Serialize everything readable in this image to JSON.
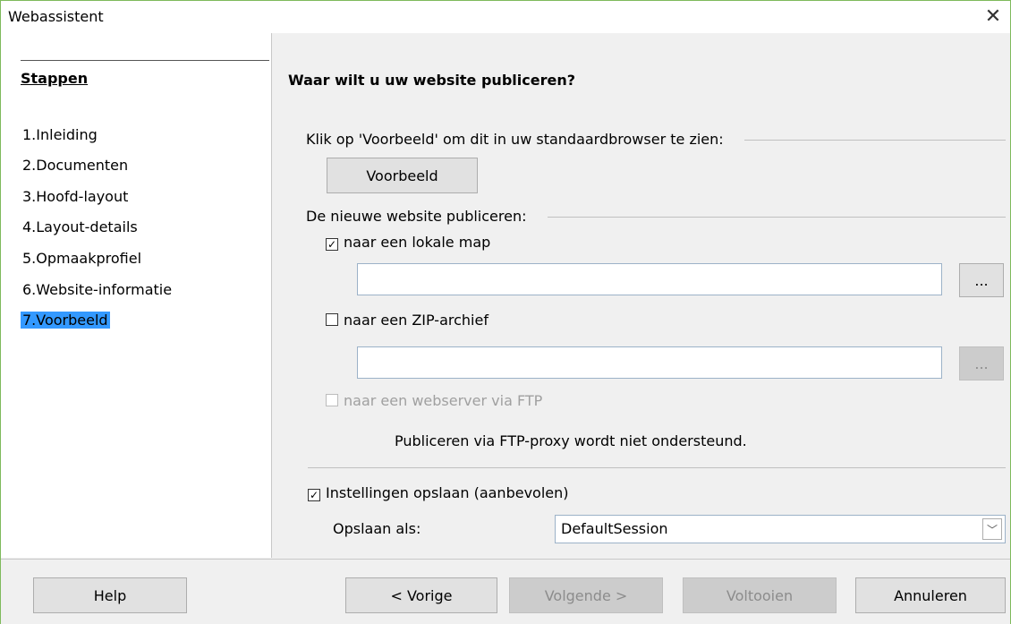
{
  "window": {
    "title": "Webassistent"
  },
  "sidebar": {
    "title": "Stappen",
    "steps": [
      "1.Inleiding",
      "2.Documenten",
      "3.Hoofd-layout",
      "4.Layout-details",
      "5.Opmaakprofiel",
      "6.Website-informatie",
      "7.Voorbeeld"
    ],
    "active_index": 6
  },
  "main": {
    "heading": "Waar wilt u uw website publiceren?",
    "preview_prompt": "Klik op 'Voorbeeld' om dit in uw standaardbrowser te zien:",
    "preview_button": "Voorbeeld",
    "publish_label": "De nieuwe website publiceren:",
    "local_folder": {
      "label": "naar een lokale map",
      "checked": true,
      "value": "",
      "browse": "..."
    },
    "zip_archive": {
      "label": "naar een ZIP-archief",
      "checked": false,
      "value": "",
      "browse": "..."
    },
    "ftp": {
      "label": "naar een webserver via FTP",
      "checked": false,
      "enabled": false
    },
    "ftp_note": "Publiceren via FTP-proxy wordt niet ondersteund.",
    "save_settings": {
      "label": "Instellingen opslaan (aanbevolen)",
      "checked": true
    },
    "save_as": {
      "label": "Opslaan als:",
      "value": "DefaultSession"
    }
  },
  "footer": {
    "help": "Help",
    "previous": "< Vorige",
    "next": "Volgende >",
    "finish": "Voltooien",
    "cancel": "Annuleren"
  },
  "icons": {
    "close": "close-icon",
    "check": "checkmark-icon",
    "dropdown": "chevron-down-icon"
  },
  "colors": {
    "accent": "#3399ff",
    "border": "#7fba5c"
  }
}
